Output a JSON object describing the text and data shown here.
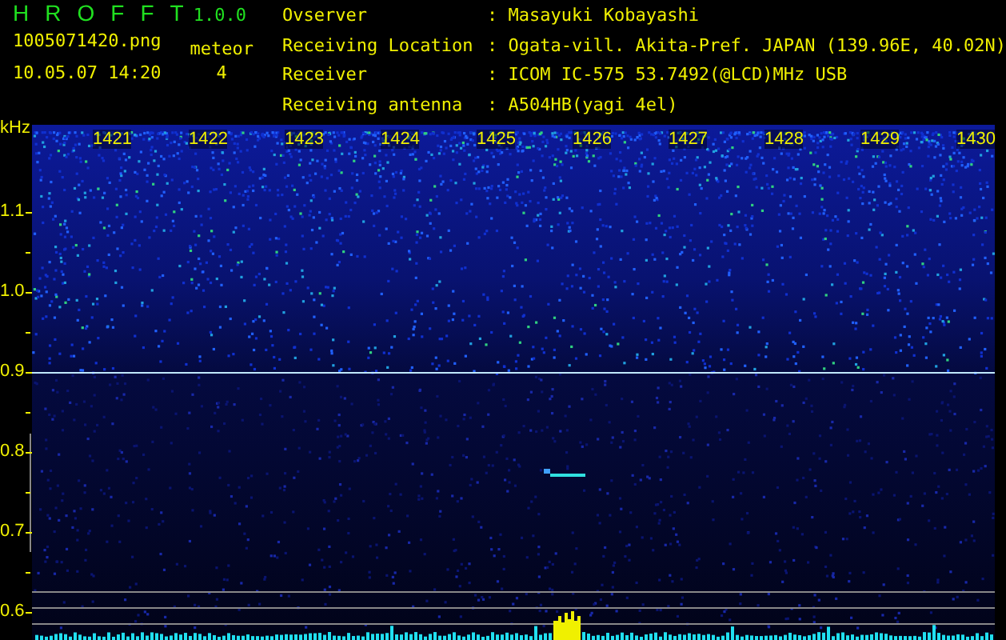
{
  "app": {
    "title_letters": [
      "H",
      "R",
      "O",
      "F",
      "F",
      "T"
    ],
    "version": "1.0.0",
    "filename": "1005071420.png",
    "datetime": "10.05.07 14:20",
    "meteor_label": "meteor",
    "meteor_count": "4"
  },
  "info": [
    {
      "label": "Ovserver",
      "value": ": Masayuki Kobayashi"
    },
    {
      "label": "Receiving Location",
      "value": ": Ogata-vill. Akita-Pref. JAPAN (139.96E, 40.02N)"
    },
    {
      "label": "Receiver",
      "value": ": ICOM IC-575 53.7492(@LCD)MHz USB"
    },
    {
      "label": "Receiving antenna",
      "value": ": A504HB(yagi 4el)"
    }
  ],
  "spectrogram": {
    "freq_unit": "kHz",
    "time_ticks": [
      "1421",
      "1422",
      "1423",
      "1424",
      "1425",
      "1426",
      "1427",
      "1428",
      "1429",
      "1430"
    ],
    "freq_ticks": [
      "1.1",
      "1.0",
      "0.9",
      "0.8",
      "0.7",
      "0.6"
    ]
  }
}
